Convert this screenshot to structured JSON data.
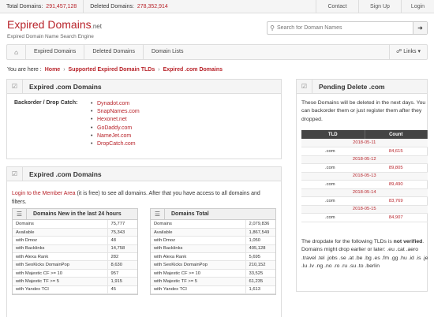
{
  "topbar": {
    "total_label": "Total Domains:",
    "total_value": "291,457,128",
    "deleted_label": "Deleted Domains:",
    "deleted_value": "278,352,914",
    "nav": [
      "Contact",
      "Sign Up",
      "Login"
    ]
  },
  "brand": {
    "name": "Expired Domains",
    "tld": ".net",
    "tagline": "Expired Domain Name Search Engine"
  },
  "search": {
    "placeholder": "Search for Domain Names"
  },
  "icons": {
    "search": "search-icon",
    "go": "arrow-right-icon",
    "home": "home-icon",
    "links": "link-icon",
    "panel": "checkbox-icon",
    "list": "list-icon"
  },
  "navbar": {
    "items": [
      "Expired Domains",
      "Deleted Domains",
      "Domain Lists"
    ],
    "links_label": "Links"
  },
  "breadcrumb": {
    "prefix": "You are here :",
    "items": [
      "Home",
      "Supported Expired Domain TLDs",
      "Expired .com Domains"
    ]
  },
  "backorder_panel": {
    "title": "Expired .com Domains",
    "label": "Backorder / Drop Catch:",
    "registrars": [
      "Dynadot.com",
      "SnapNames.com",
      "Hexonet.net",
      "GoDaddy.com",
      "NameJet.com",
      "DropCatch.com"
    ]
  },
  "stats_panel": {
    "title": "Expired .com Domains",
    "intro_link": "Login to the Member Area",
    "intro_text": " (it is free) to see all domains. After that you have access to all domains and filters.",
    "new_table": {
      "title": "Domains New in the last 24 hours",
      "rows": [
        [
          "Domains",
          "75,777"
        ],
        [
          "Available",
          "75,343"
        ],
        [
          "with Dmoz",
          "48"
        ],
        [
          "with Backlinks",
          "14,758"
        ],
        [
          "with Alexa Rank",
          "282"
        ],
        [
          "with SeoKicks DomainPop",
          "8,630"
        ],
        [
          "with Majestic CF >= 10",
          "957"
        ],
        [
          "with Majestic TF >= 5",
          "1,915"
        ],
        [
          "with Yandex TCI",
          "45"
        ]
      ]
    },
    "total_table": {
      "title": "Domains Total",
      "rows": [
        [
          "Domains",
          "2,079,836"
        ],
        [
          "Available",
          "1,867,549"
        ],
        [
          "with Dmoz",
          "1,050"
        ],
        [
          "with Backlinks",
          "405,128"
        ],
        [
          "with Alexa Rank",
          "5,695"
        ],
        [
          "with SeoKicks DomainPop",
          "210,152"
        ],
        [
          "with Majestic CF >= 10",
          "33,525"
        ],
        [
          "with Majestic TF >= 5",
          "61,235"
        ],
        [
          "with Yandex TCI",
          "1,613"
        ]
      ]
    }
  },
  "pending_panel": {
    "title": "Pending Delete .com",
    "description": "These Domains will be deleted in the next days. You can backorder them or just register them after they dropped.",
    "columns": [
      "TLD",
      "Count"
    ],
    "groups": [
      {
        "date": "2018-05-11",
        "tld": ".com",
        "count": "84,615"
      },
      {
        "date": "2018-05-12",
        "tld": ".com",
        "count": "89,805"
      },
      {
        "date": "2018-05-13",
        "tld": ".com",
        "count": "89,490"
      },
      {
        "date": "2018-05-14",
        "tld": ".com",
        "count": "83,769"
      },
      {
        "date": "2018-05-15",
        "tld": ".com",
        "count": "84,907"
      }
    ],
    "footer_pre": "The dropdate for the following TLDs is ",
    "footer_bold": "not verified",
    "footer_post": ". Domains might drop earlier or later: .eu .cat .aero .travel .tel .jobs .se .at .be .bg .es .fm .gg .hu .id .is .je .lu .lv .ng .no .ro .ru .su .to .berlin"
  }
}
